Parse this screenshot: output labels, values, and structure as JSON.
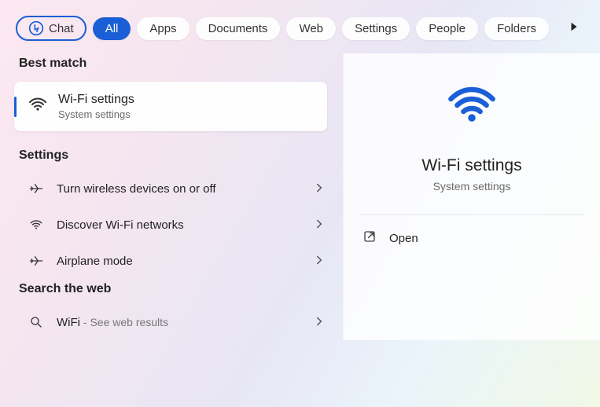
{
  "tabs": {
    "chat": "Chat",
    "all": "All",
    "apps": "Apps",
    "documents": "Documents",
    "web": "Web",
    "settings": "Settings",
    "people": "People",
    "folders": "Folders"
  },
  "sections": {
    "best_match": "Best match",
    "settings": "Settings",
    "search_web": "Search the web"
  },
  "best": {
    "title": "Wi-Fi settings",
    "subtitle": "System settings"
  },
  "settings_items": {
    "wireless_toggle": "Turn wireless devices on or off",
    "discover": "Discover Wi-Fi networks",
    "airplane": "Airplane mode"
  },
  "web_search": {
    "term": "WiFi",
    "hint": " - See web results"
  },
  "preview": {
    "title": "Wi-Fi settings",
    "subtitle": "System settings",
    "open": "Open"
  }
}
